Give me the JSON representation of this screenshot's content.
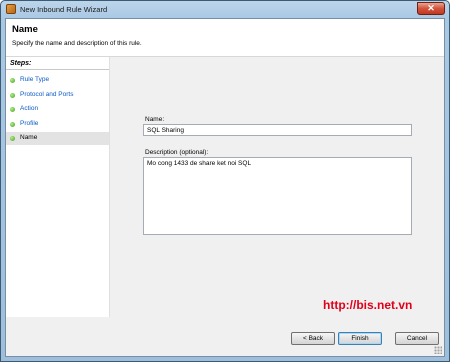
{
  "window": {
    "title": "New Inbound Rule Wizard",
    "close_glyph": "✕"
  },
  "header": {
    "title": "Name",
    "subtitle": "Specify the name and description of this rule."
  },
  "steps": {
    "title": "Steps:",
    "items": [
      {
        "label": "Rule Type"
      },
      {
        "label": "Protocol and Ports"
      },
      {
        "label": "Action"
      },
      {
        "label": "Profile"
      },
      {
        "label": "Name"
      }
    ]
  },
  "form": {
    "name_label": "Name:",
    "name_value": "SQL Sharing",
    "description_label": "Description (optional):",
    "description_value": "Mo cong 1433 de share ket noi SQL"
  },
  "buttons": {
    "back": "< Back",
    "finish": "Finish",
    "cancel": "Cancel"
  },
  "watermark": "http://bis.net.vn",
  "colors": {
    "step_link": "#0c5ac6",
    "step_dot": "#3f9f17",
    "watermark": "#e0001a"
  }
}
